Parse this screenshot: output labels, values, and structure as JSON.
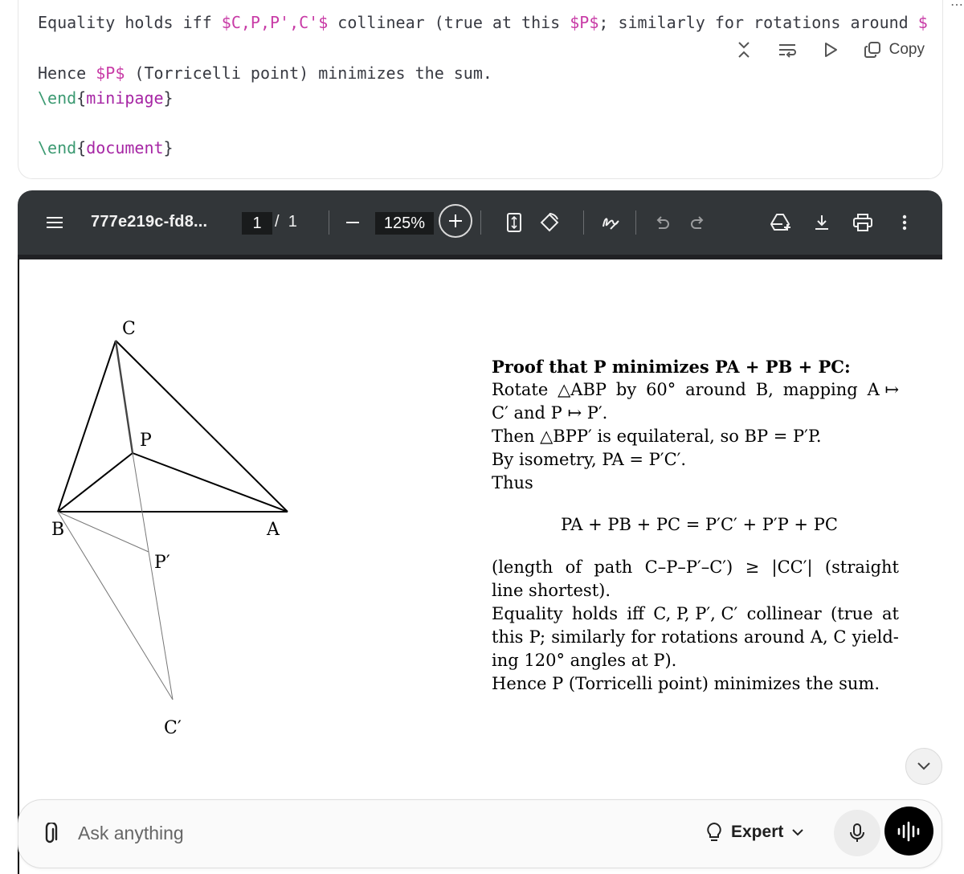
{
  "code": {
    "line1": {
      "t1": "Equality holds iff ",
      "m1": "$C,P,P',C'$",
      "t2": " collinear (true at this ",
      "m2": "$P$",
      "t3": "; similarly for rotations around ",
      "m3": "$"
    },
    "line2": {
      "t1": "Hence ",
      "m1": "$P$",
      "t2": " (Torricelli point) minimizes the sum."
    },
    "line3": {
      "cmd": "\\end",
      "open": "{",
      "arg": "minipage",
      "close": "}"
    },
    "line4": {
      "cmd": "\\end",
      "open": "{",
      "arg": "document",
      "close": "}"
    },
    "toolbar": {
      "copy_label": "Copy"
    },
    "corner": "⋯"
  },
  "pdf": {
    "title": "777e219c-fd8...",
    "page_current": "1",
    "page_sep": "/",
    "page_total": "1",
    "zoom": "125%"
  },
  "figure": {
    "labels": {
      "C": "C",
      "P": "P",
      "B": "B",
      "A": "A",
      "Pp": "P′",
      "Cp": "C′"
    }
  },
  "proof": {
    "heading": "Proof that P minimizes PA + PB + PC:",
    "l1": [
      "Rotate",
      "△ABP",
      "by",
      "60°",
      "around",
      "B,",
      "mapping",
      "A ↦"
    ],
    "l2": "C′ and P ↦ P′.",
    "l3": "Then △BPP′ is equilateral, so BP = P′P.",
    "l4": "By isometry, PA = P′C′.",
    "l5": "Thus",
    "equation": "PA + PB + PC = P′C′ + P′P + PC",
    "l6": [
      "(length",
      "of",
      "path",
      "C–P–P′–C′)",
      "≥",
      "|CC′|",
      "(straight"
    ],
    "l7": "line shortest).",
    "l8": [
      "Equality",
      "holds",
      "iff",
      "C, P, P′, C′",
      "collinear",
      "(true",
      "at"
    ],
    "l9": [
      "this",
      "P;",
      "similarly",
      "for",
      "rotations",
      "around",
      "A, C",
      "yield-"
    ],
    "l10": "ing 120° angles at P).",
    "l11": "Hence P (Torricelli point) minimizes the sum."
  },
  "input": {
    "placeholder": "Ask anything",
    "mode_label": "Expert"
  },
  "icons": {
    "collapse": "collapse-icon",
    "wrap": "wrap-icon",
    "run": "play-icon",
    "copy": "copy-icon",
    "menu": "menu-icon",
    "zoom_out": "minus-icon",
    "zoom_in": "plus-icon",
    "fit": "fit-page-icon",
    "rotate": "rotate-icon",
    "draw": "draw-icon",
    "undo": "undo-icon",
    "redo": "redo-icon",
    "drive": "drive-add-icon",
    "download": "download-icon",
    "print": "print-icon",
    "more": "more-vert-icon",
    "attach": "paperclip-icon",
    "lightbulb": "lightbulb-icon",
    "chevron": "chevron-down-icon",
    "mic": "mic-icon",
    "voice": "voice-waveform-icon"
  }
}
